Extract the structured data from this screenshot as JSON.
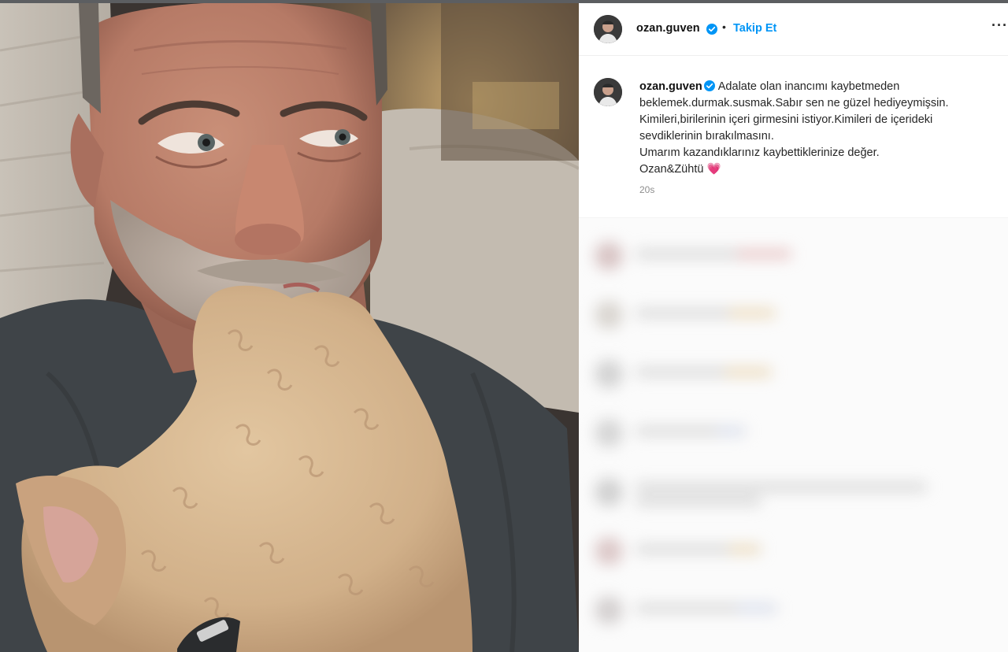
{
  "post": {
    "username": "ozan.guven",
    "follow_label": "Takip Et",
    "separator": "•",
    "more_label": "···",
    "caption_lines": [
      "Adalate olan inancımı kaybetmeden",
      "beklemek.durmak.susmak.Sabır sen ne güzel hediyeymişsin.",
      "Kimileri,birilerinin içeri girmesini istiyor.Kimileri de içerideki",
      "sevdiklerinin bırakılmasını.",
      "Umarım kazandıklarınız kaybettiklerinize değer.",
      "Ozan&Zühtü"
    ],
    "heart_emoji": "💗",
    "timestamp": "20s"
  },
  "icons": {
    "verified": "verified-badge-icon",
    "more": "more-options-icon"
  },
  "colors": {
    "follow_blue": "#0095f6",
    "verified_blue": "#0095f6",
    "heart": "#e8336b"
  }
}
